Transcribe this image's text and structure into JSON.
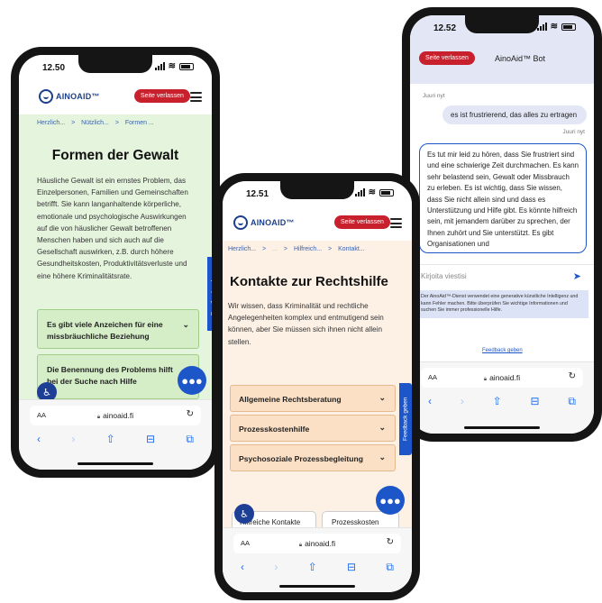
{
  "brand": {
    "logo_text": "AINOAID™"
  },
  "common": {
    "exit_label": "Seite verlassen",
    "url": "ainoaid.fi",
    "aa_label": "AA",
    "feedback_label": "Feedback geben"
  },
  "phone1": {
    "time": "12.50",
    "breadcrumbs": [
      "Herzlich...",
      ">",
      "Nützlich...",
      ">",
      "Formen ..."
    ],
    "title": "Formen der Gewalt",
    "body": "Häusliche Gewalt ist ein ernstes Problem, das Einzelpersonen, Familien und Gemeinschaften betrifft. Sie kann langanhaltende körperliche, emotionale und psychologische Auswirkungen auf die von häuslicher Gewalt betroffenen Menschen haben und sich auch auf die Gesellschaft auswirken, z.B. durch höhere Gesundheitskosten, Produktivitätsverluste und eine höhere Kriminalitätsrate.",
    "accordion": [
      "Es gibt viele Anzeichen für eine missbräuchliche Beziehung",
      "Die Benennung des Problems hilft bei der Suche nach Hilfe"
    ]
  },
  "phone2": {
    "time": "12.51",
    "breadcrumbs": [
      "Herzlich...",
      ">",
      "...",
      ">",
      "Hilfreich...",
      ">",
      "Kontakt..."
    ],
    "title": "Kontakte zur Rechtshilfe",
    "body": "Wir wissen, dass Kriminalität und rechtliche Angelegenheiten komplex und entmutigend sein können, aber Sie müssen sich ihnen nicht allein stellen.",
    "accordion": [
      "Allgemeine Rechtsberatung",
      "Prozesskostenhilfe",
      "Psychosoziale Prozessbegleitung"
    ],
    "tabs": [
      "Hilfreiche Kontakte",
      "Prozesskosten"
    ]
  },
  "phone3": {
    "time": "12.52",
    "bot_title": "AinoAid™ Bot",
    "top_timestamp": "Juuri nyt",
    "user_message": "es ist frustrierend, das alles zu ertragen",
    "user_timestamp": "Juuri nyt",
    "bot_message": "Es tut mir leid zu hören, dass Sie frustriert sind und eine schwierige Zeit durchmachen. Es kann sehr belastend sein, Gewalt oder Missbrauch zu erleben. Es ist wichtig, dass Sie wissen, dass Sie nicht allein sind und dass es Unterstützung und Hilfe gibt. Es könnte hilfreich sein, mit jemandem darüber zu sprechen, der Ihnen zuhört und Sie unterstützt. Es gibt Organisationen und",
    "input_placeholder": "Kirjoita viestisi",
    "disclaimer": "Der AinoAid™-Dienst verwendet eine generative künstliche Intelligenz und kann Fehler machen. Bitte überprüfen Sie wichtige Informationen und suchen Sie immer professionelle Hilfe.",
    "feedback_link": "Feedback geben"
  },
  "colors": {
    "green_bg": "#e5f4dd",
    "green_card": "#d5eec8",
    "peach_bg": "#fdf0e4",
    "peach_card": "#fbe0c6",
    "lavender": "#e3e7f5",
    "exit_red": "#c8202c",
    "brand_blue": "#1d56c9"
  },
  "icons": [
    "chevron-down-icon",
    "chat-icon",
    "accessibility-icon",
    "send-icon",
    "lock-icon",
    "reload-icon",
    "share-icon",
    "bookmarks-icon",
    "tabs-icon"
  ]
}
